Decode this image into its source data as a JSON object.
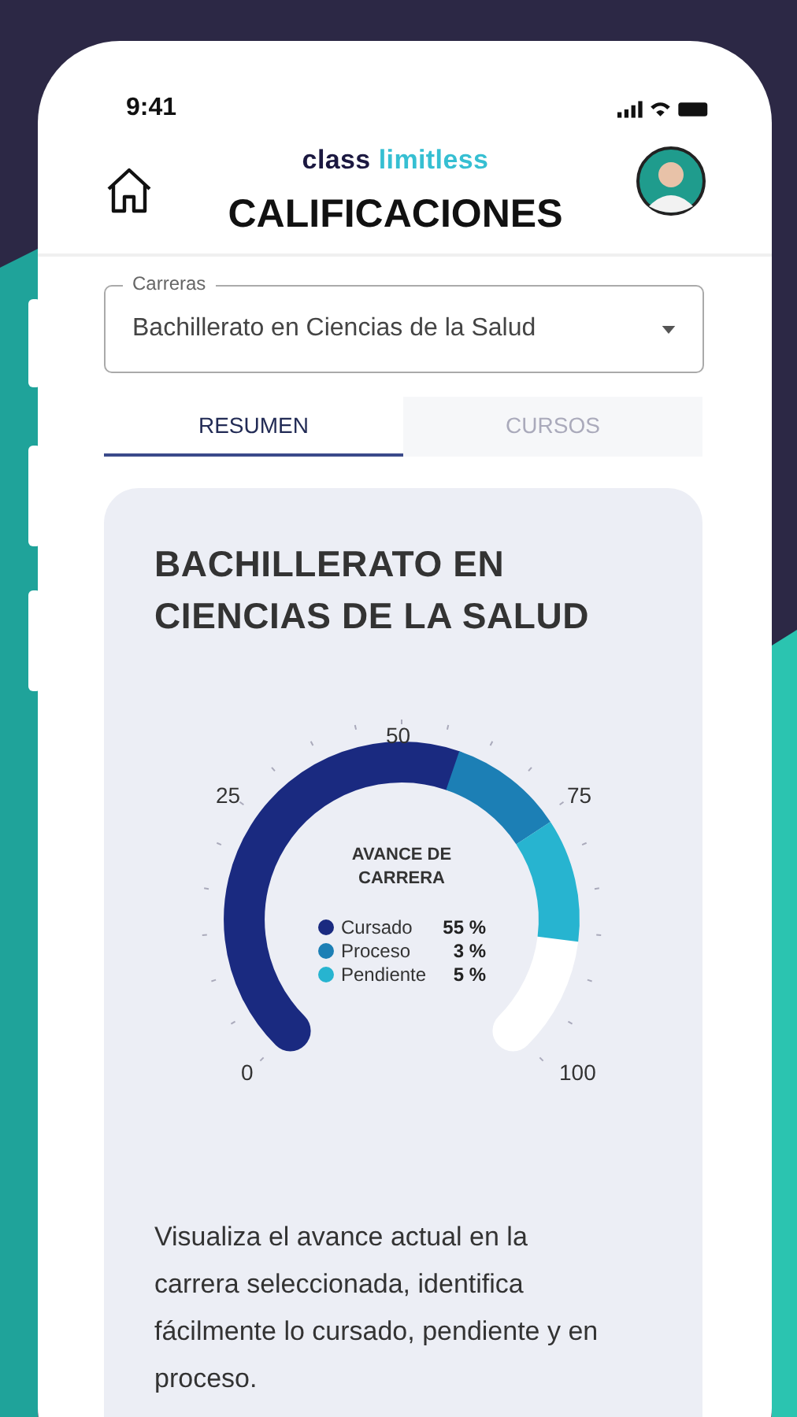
{
  "status_bar": {
    "time": "9:41"
  },
  "header": {
    "logo": [
      "cl",
      "ass",
      "limitless"
    ],
    "title": "CALIFICACIONES"
  },
  "career_select": {
    "label": "Carreras",
    "value": "Bachillerato en Ciencias de la Salud"
  },
  "tabs": [
    {
      "label": "RESUMEN",
      "selected": true
    },
    {
      "label": "CURSOS",
      "selected": false
    }
  ],
  "card": {
    "title": "BACHILLERATO EN CIENCIAS DE LA SALUD",
    "gauge": {
      "ticks": [
        "0",
        "25",
        "50",
        "75",
        "100"
      ],
      "caption": "AVANCE DE CARRERA",
      "legend": [
        {
          "label": "Cursado",
          "value": "55 %",
          "color": "#1a2a80"
        },
        {
          "label": "Proceso",
          "value": "3 %",
          "color": "#1c7fb5"
        },
        {
          "label": "Pendiente",
          "value": "5 %",
          "color": "#27b4d0"
        }
      ]
    },
    "description": "Visualiza el avance actual en la carrera seleccionada, identifica fácilmente lo cursado, pendiente y en proceso."
  }
}
